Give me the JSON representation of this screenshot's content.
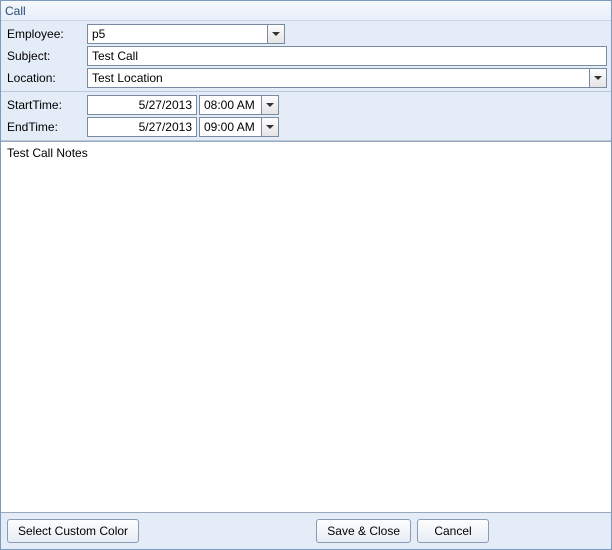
{
  "window": {
    "title": "Call"
  },
  "labels": {
    "employee": "Employee:",
    "subject": "Subject:",
    "location": "Location:",
    "start_time": "StartTime:",
    "end_time": "EndTime:"
  },
  "fields": {
    "employee": "p5",
    "subject": "Test Call",
    "location": "Test Location",
    "start_date": "5/27/2013",
    "start_time": "08:00 AM",
    "end_date": "5/27/2013",
    "end_time": "09:00 AM",
    "notes": "Test Call Notes"
  },
  "buttons": {
    "custom_color": "Select Custom Color",
    "save_close": "Save & Close",
    "cancel": "Cancel"
  }
}
